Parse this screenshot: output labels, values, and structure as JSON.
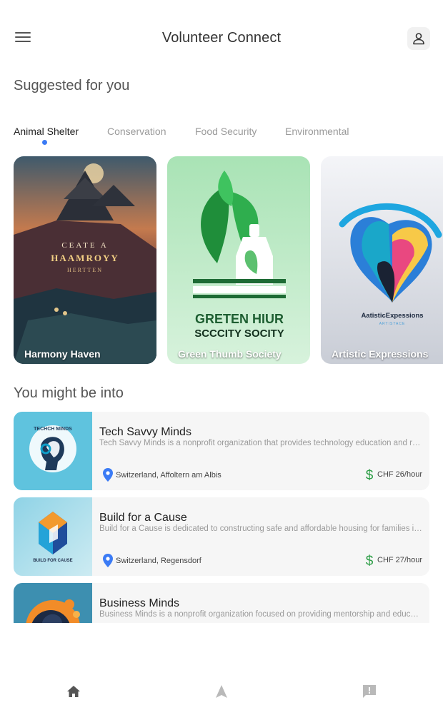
{
  "header": {
    "title": "Volunteer Connect",
    "menu_icon": "hamburger-menu-icon",
    "profile_icon": "person-icon"
  },
  "suggested": {
    "title": "Suggested for you",
    "tabs": [
      {
        "label": "Animal Shelter",
        "active": true
      },
      {
        "label": "Conservation",
        "active": false
      },
      {
        "label": "Food Security",
        "active": false
      },
      {
        "label": "Environmental",
        "active": false
      }
    ],
    "cards": [
      {
        "name": "Harmony Haven",
        "art_text": [
          "CEATE A",
          "HAAMROYY",
          "HERTTEN"
        ]
      },
      {
        "name": "Green Thumb Society",
        "art_text": [
          "GRETEN HIUR",
          "SCCCITY SOCITY"
        ]
      },
      {
        "name": "Artistic Expressions",
        "art_text": [
          "AatisticExpessions",
          "ARTISTACE"
        ]
      }
    ]
  },
  "recommended": {
    "title": "You might be into",
    "items": [
      {
        "name": "Tech Savvy Minds",
        "description": "Tech Savvy Minds is a nonprofit organization that provides technology education and resources",
        "location": "Switzerland, Affoltern am Albis",
        "rate": "CHF 26/hour",
        "logo_text": "TECHCH MINDS"
      },
      {
        "name": "Build for a Cause",
        "description": "Build for a Cause is dedicated to constructing safe and affordable housing for families in need",
        "location": "Switzerland, Regensdorf",
        "rate": "CHF 27/hour",
        "logo_text": "BUILD FOR CAUSE"
      },
      {
        "name": "Business Minds",
        "description": "Business Minds is a nonprofit organization focused on providing mentorship and education",
        "location": "",
        "rate": ""
      }
    ]
  },
  "bottom_nav": {
    "items": [
      {
        "icon": "home-icon",
        "active": true
      },
      {
        "icon": "navigation-arrow-icon",
        "active": false
      },
      {
        "icon": "feedback-icon",
        "active": false
      }
    ]
  },
  "colors": {
    "accent": "#3b7bf5",
    "location_pin": "#3b7bf5",
    "rate_dollar": "#2e9e47",
    "card_label": "#ffffff"
  }
}
